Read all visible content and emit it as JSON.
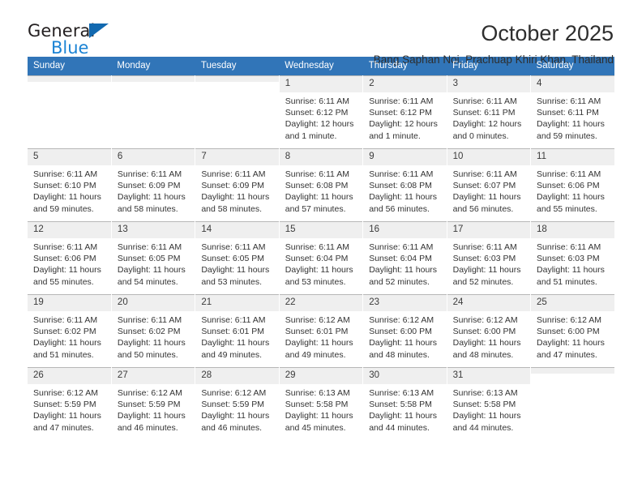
{
  "brand": {
    "name_top": "General",
    "name_bottom": "Blue",
    "triangle_color": "#1269b0",
    "blue_text_color": "#1b83d4"
  },
  "header": {
    "month_title": "October 2025",
    "location": "Bang Saphan Noi, Prachuap Khiri Khan, Thailand"
  },
  "theme": {
    "header_bg": "#3175b8",
    "header_text": "#ffffff",
    "daynum_bg": "#efefef",
    "grid_line": "#b7b7b7"
  },
  "weekdays": [
    "Sunday",
    "Monday",
    "Tuesday",
    "Wednesday",
    "Thursday",
    "Friday",
    "Saturday"
  ],
  "labels": {
    "sunrise_prefix": "Sunrise:",
    "sunset_prefix": "Sunset:",
    "daylight_prefix": "Daylight:"
  },
  "weeks": [
    [
      {
        "day": "",
        "empty": true
      },
      {
        "day": "",
        "empty": true
      },
      {
        "day": "",
        "empty": true
      },
      {
        "day": "1",
        "sunrise": "Sunrise: 6:11 AM",
        "sunset": "Sunset: 6:12 PM",
        "daylight": "Daylight: 12 hours and 1 minute."
      },
      {
        "day": "2",
        "sunrise": "Sunrise: 6:11 AM",
        "sunset": "Sunset: 6:12 PM",
        "daylight": "Daylight: 12 hours and 1 minute."
      },
      {
        "day": "3",
        "sunrise": "Sunrise: 6:11 AM",
        "sunset": "Sunset: 6:11 PM",
        "daylight": "Daylight: 12 hours and 0 minutes."
      },
      {
        "day": "4",
        "sunrise": "Sunrise: 6:11 AM",
        "sunset": "Sunset: 6:11 PM",
        "daylight": "Daylight: 11 hours and 59 minutes."
      }
    ],
    [
      {
        "day": "5",
        "sunrise": "Sunrise: 6:11 AM",
        "sunset": "Sunset: 6:10 PM",
        "daylight": "Daylight: 11 hours and 59 minutes."
      },
      {
        "day": "6",
        "sunrise": "Sunrise: 6:11 AM",
        "sunset": "Sunset: 6:09 PM",
        "daylight": "Daylight: 11 hours and 58 minutes."
      },
      {
        "day": "7",
        "sunrise": "Sunrise: 6:11 AM",
        "sunset": "Sunset: 6:09 PM",
        "daylight": "Daylight: 11 hours and 58 minutes."
      },
      {
        "day": "8",
        "sunrise": "Sunrise: 6:11 AM",
        "sunset": "Sunset: 6:08 PM",
        "daylight": "Daylight: 11 hours and 57 minutes."
      },
      {
        "day": "9",
        "sunrise": "Sunrise: 6:11 AM",
        "sunset": "Sunset: 6:08 PM",
        "daylight": "Daylight: 11 hours and 56 minutes."
      },
      {
        "day": "10",
        "sunrise": "Sunrise: 6:11 AM",
        "sunset": "Sunset: 6:07 PM",
        "daylight": "Daylight: 11 hours and 56 minutes."
      },
      {
        "day": "11",
        "sunrise": "Sunrise: 6:11 AM",
        "sunset": "Sunset: 6:06 PM",
        "daylight": "Daylight: 11 hours and 55 minutes."
      }
    ],
    [
      {
        "day": "12",
        "sunrise": "Sunrise: 6:11 AM",
        "sunset": "Sunset: 6:06 PM",
        "daylight": "Daylight: 11 hours and 55 minutes."
      },
      {
        "day": "13",
        "sunrise": "Sunrise: 6:11 AM",
        "sunset": "Sunset: 6:05 PM",
        "daylight": "Daylight: 11 hours and 54 minutes."
      },
      {
        "day": "14",
        "sunrise": "Sunrise: 6:11 AM",
        "sunset": "Sunset: 6:05 PM",
        "daylight": "Daylight: 11 hours and 53 minutes."
      },
      {
        "day": "15",
        "sunrise": "Sunrise: 6:11 AM",
        "sunset": "Sunset: 6:04 PM",
        "daylight": "Daylight: 11 hours and 53 minutes."
      },
      {
        "day": "16",
        "sunrise": "Sunrise: 6:11 AM",
        "sunset": "Sunset: 6:04 PM",
        "daylight": "Daylight: 11 hours and 52 minutes."
      },
      {
        "day": "17",
        "sunrise": "Sunrise: 6:11 AM",
        "sunset": "Sunset: 6:03 PM",
        "daylight": "Daylight: 11 hours and 52 minutes."
      },
      {
        "day": "18",
        "sunrise": "Sunrise: 6:11 AM",
        "sunset": "Sunset: 6:03 PM",
        "daylight": "Daylight: 11 hours and 51 minutes."
      }
    ],
    [
      {
        "day": "19",
        "sunrise": "Sunrise: 6:11 AM",
        "sunset": "Sunset: 6:02 PM",
        "daylight": "Daylight: 11 hours and 51 minutes."
      },
      {
        "day": "20",
        "sunrise": "Sunrise: 6:11 AM",
        "sunset": "Sunset: 6:02 PM",
        "daylight": "Daylight: 11 hours and 50 minutes."
      },
      {
        "day": "21",
        "sunrise": "Sunrise: 6:11 AM",
        "sunset": "Sunset: 6:01 PM",
        "daylight": "Daylight: 11 hours and 49 minutes."
      },
      {
        "day": "22",
        "sunrise": "Sunrise: 6:12 AM",
        "sunset": "Sunset: 6:01 PM",
        "daylight": "Daylight: 11 hours and 49 minutes."
      },
      {
        "day": "23",
        "sunrise": "Sunrise: 6:12 AM",
        "sunset": "Sunset: 6:00 PM",
        "daylight": "Daylight: 11 hours and 48 minutes."
      },
      {
        "day": "24",
        "sunrise": "Sunrise: 6:12 AM",
        "sunset": "Sunset: 6:00 PM",
        "daylight": "Daylight: 11 hours and 48 minutes."
      },
      {
        "day": "25",
        "sunrise": "Sunrise: 6:12 AM",
        "sunset": "Sunset: 6:00 PM",
        "daylight": "Daylight: 11 hours and 47 minutes."
      }
    ],
    [
      {
        "day": "26",
        "sunrise": "Sunrise: 6:12 AM",
        "sunset": "Sunset: 5:59 PM",
        "daylight": "Daylight: 11 hours and 47 minutes."
      },
      {
        "day": "27",
        "sunrise": "Sunrise: 6:12 AM",
        "sunset": "Sunset: 5:59 PM",
        "daylight": "Daylight: 11 hours and 46 minutes."
      },
      {
        "day": "28",
        "sunrise": "Sunrise: 6:12 AM",
        "sunset": "Sunset: 5:59 PM",
        "daylight": "Daylight: 11 hours and 46 minutes."
      },
      {
        "day": "29",
        "sunrise": "Sunrise: 6:13 AM",
        "sunset": "Sunset: 5:58 PM",
        "daylight": "Daylight: 11 hours and 45 minutes."
      },
      {
        "day": "30",
        "sunrise": "Sunrise: 6:13 AM",
        "sunset": "Sunset: 5:58 PM",
        "daylight": "Daylight: 11 hours and 44 minutes."
      },
      {
        "day": "31",
        "sunrise": "Sunrise: 6:13 AM",
        "sunset": "Sunset: 5:58 PM",
        "daylight": "Daylight: 11 hours and 44 minutes."
      },
      {
        "day": "",
        "empty": true
      }
    ]
  ]
}
